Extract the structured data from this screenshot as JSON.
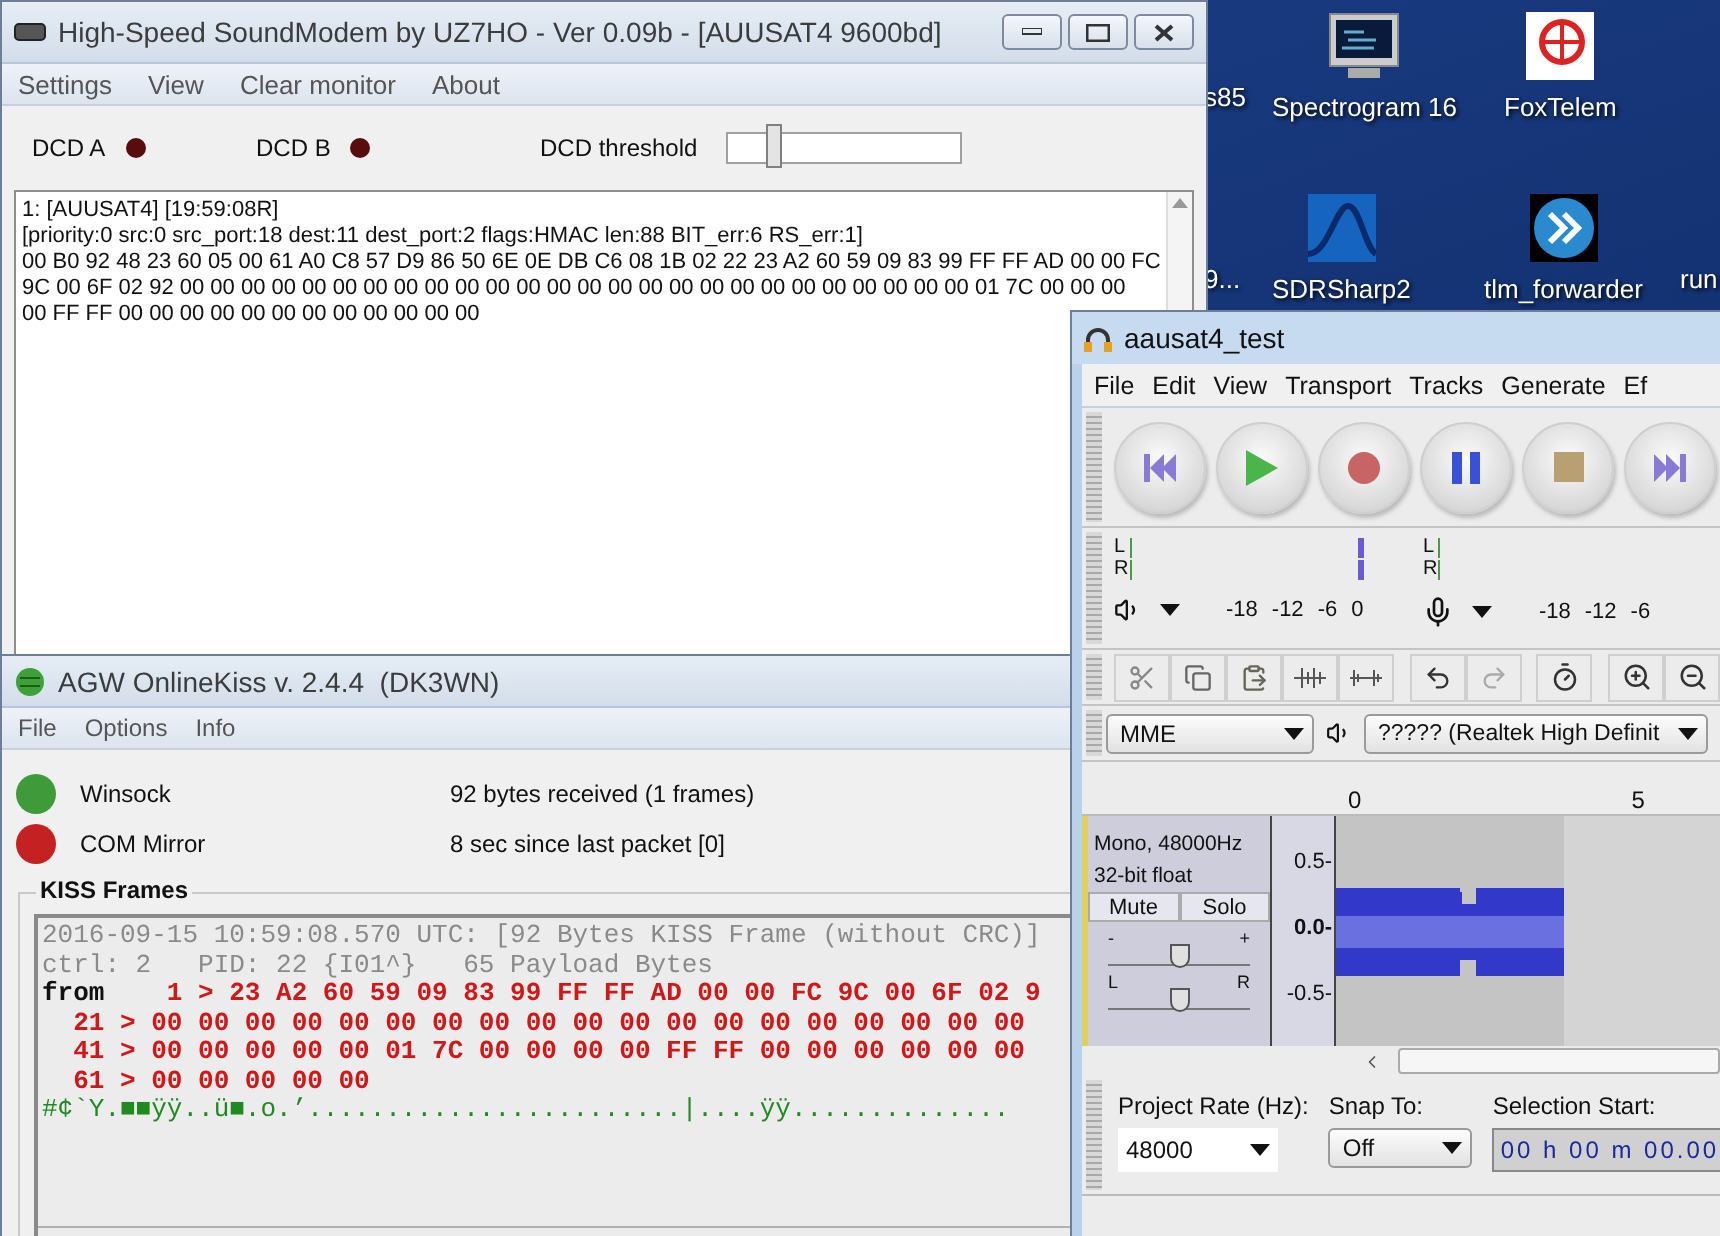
{
  "soundmodem": {
    "title": "High-Speed SoundModem by UZ7HO - Ver 0.09b - [AUUSAT4 9600bd]",
    "menu": [
      "Settings",
      "View",
      "Clear monitor",
      "About"
    ],
    "dcd": [
      {
        "label": "DCD A",
        "on": false
      },
      {
        "label": "DCD B",
        "on": false
      }
    ],
    "threshold": {
      "label": "DCD threshold",
      "level": 0.2
    },
    "monitor": [
      "1: [AUUSAT4] [19:59:08R]",
      "[priority:0 src:0 src_port:18 dest:11 dest_port:2 flags:HMAC len:88 BIT_err:6 RS_err:1]",
      "00 B0 92 48 23 60 05 00 61 A0 C8 57 D9 86 50 6E 0E DB C6 08 1B 02 22 23 A2 60 59 09 83 99 FF FF AD 00 00 FC",
      "9C 00 6F 02 92 00 00 00 00 00 00 00 00 00 00 00 00 00 00 00 00 00 00 00 00 00 00 00 00 00 00 01 7C 00 00 00",
      "00 FF FF 00 00 00 00 00 00 00 00 00 00 00 00"
    ]
  },
  "desktop_icons": [
    {
      "label": "s85"
    },
    {
      "label": "Spectrogram 16",
      "kind": "monitor"
    },
    {
      "label": "FoxTelem",
      "kind": "globe"
    },
    {
      "label": "9..."
    },
    {
      "label": "SDRSharp2",
      "kind": "wave"
    },
    {
      "label": "tlm_forwarder",
      "kind": "arrows"
    },
    {
      "label": "run"
    }
  ],
  "agw": {
    "title": "AGW OnlineKiss v. 2.4.4  (DK3WN)",
    "menu": [
      "File",
      "Options",
      "Info"
    ],
    "status": [
      {
        "label": "Winsock",
        "info": "92 bytes received (1 frames)",
        "color": "#3f9a3a"
      },
      {
        "label": "COM Mirror",
        "info": "8 sec since last packet [0]",
        "color": "#c42222"
      }
    ],
    "frames_title": "KISS Frames",
    "frame_lines": [
      {
        "kind": "header",
        "text": "2016-09-15 10:59:08.570 UTC: [92 Bytes KISS Frame (without CRC)]"
      },
      {
        "kind": "header",
        "text": "ctrl: 2   PID: 22 {I01^}   65 Payload Bytes"
      },
      {
        "kind": "hex",
        "prefix": "from",
        "text": "    1 > 23 A2 60 59 09 83 99 FF FF AD 00 00 FC 9C 00 6F 02 9"
      },
      {
        "kind": "hex",
        "text": "  21 > 00 00 00 00 00 00 00 00 00 00 00 00 00 00 00 00 00 00 00"
      },
      {
        "kind": "hex",
        "text": "  41 > 00 00 00 00 00 01 7C 00 00 00 00 FF FF 00 00 00 00 00 00"
      },
      {
        "kind": "hex",
        "text": "  61 > 00 00 00 00 00"
      },
      {
        "kind": "ascii",
        "text": "#¢`Y.■■ÿÿ..ü■.o.’........................|....ÿÿ.............."
      }
    ]
  },
  "audacity": {
    "title": "aausat4_test",
    "menu": [
      "File",
      "Edit",
      "View",
      "Transport",
      "Tracks",
      "Generate",
      "Ef"
    ],
    "meters": [
      {
        "kind": "playback",
        "channels": [
          "L",
          "R"
        ],
        "scale": [
          "-18",
          "-12",
          "-6",
          "0"
        ],
        "level": 0.8
      },
      {
        "kind": "recording",
        "channels": [
          "L",
          "R"
        ],
        "scale": [
          "-18",
          "-12",
          "-6"
        ]
      }
    ],
    "host": "MME",
    "output_device": "????? (Realtek High Definit",
    "ruler": [
      "0",
      "5"
    ],
    "track": {
      "info": [
        "Mono, 48000Hz",
        "32-bit float"
      ],
      "mute": "Mute",
      "solo": "Solo",
      "gain": {
        "low": "-",
        "high": "+",
        "level": 0.5
      },
      "pan": {
        "low": "L",
        "high": "R",
        "level": 0.5
      },
      "axis": [
        {
          "text": "0.5-",
          "bold": false
        },
        {
          "text": "0.0-",
          "bold": true
        },
        {
          "text": "-0.5-",
          "bold": false
        }
      ]
    },
    "rate": {
      "label": "Project Rate (Hz):",
      "value": "48000"
    },
    "snap": {
      "label": "Snap To:",
      "value": "Off"
    },
    "selection": {
      "label": "Selection Start:",
      "value": "00 h 00 m 00.00"
    }
  }
}
